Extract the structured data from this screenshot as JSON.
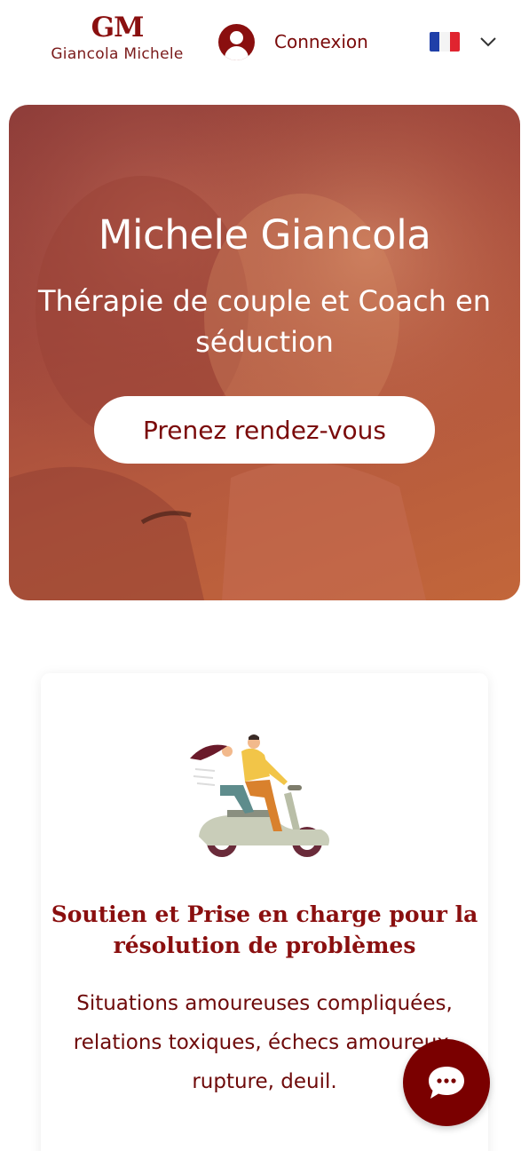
{
  "header": {
    "logo_mark": "GM",
    "logo_name": "Giancola Michele",
    "login_label": "Connexion",
    "language": "FR"
  },
  "hero": {
    "title": "Michele Giancola",
    "subtitle": "Thérapie de couple et Coach en séduction",
    "cta_label": "Prenez rendez-vous"
  },
  "card": {
    "title": "Soutien et Prise en charge pour la résolution de problèmes",
    "text": "Situations amoureuses compliquées, relations toxiques, échecs amoureux, rupture, deuil."
  },
  "colors": {
    "brand": "#8a0f0f",
    "chat_button": "#7a0000",
    "text": "#7a0a0a"
  },
  "icons": {
    "user": "user-avatar-icon",
    "flag": "france-flag-icon",
    "chevron": "chevron-down-icon",
    "chat": "chat-bubble-icon"
  }
}
